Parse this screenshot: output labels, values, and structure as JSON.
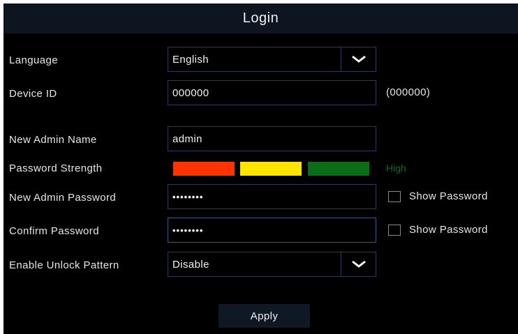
{
  "window": {
    "title": "Login"
  },
  "form": {
    "language": {
      "label": "Language",
      "value": "English"
    },
    "device_id": {
      "label": "Device ID",
      "value": "000000",
      "note": "(000000)"
    },
    "admin_name": {
      "label": "New Admin Name",
      "value": "admin"
    },
    "password_strength": {
      "label": "Password Strength",
      "level_text": "High",
      "colors": [
        "#ff3300",
        "#ffe400",
        "#0b6e16"
      ],
      "text_color": "#0b6e16"
    },
    "admin_password": {
      "label": "New Admin Password",
      "value": "••••••••",
      "show_label": "Show Password"
    },
    "confirm_password": {
      "label": "Confirm Password",
      "value": "••••••••",
      "show_label": "Show Password"
    },
    "unlock_pattern": {
      "label": "Enable Unlock Pattern",
      "value": "Disable"
    }
  },
  "buttons": {
    "apply": "Apply"
  },
  "icons": {
    "dropdown": "chevron-down-icon",
    "checkbox": "checkbox-icon"
  }
}
